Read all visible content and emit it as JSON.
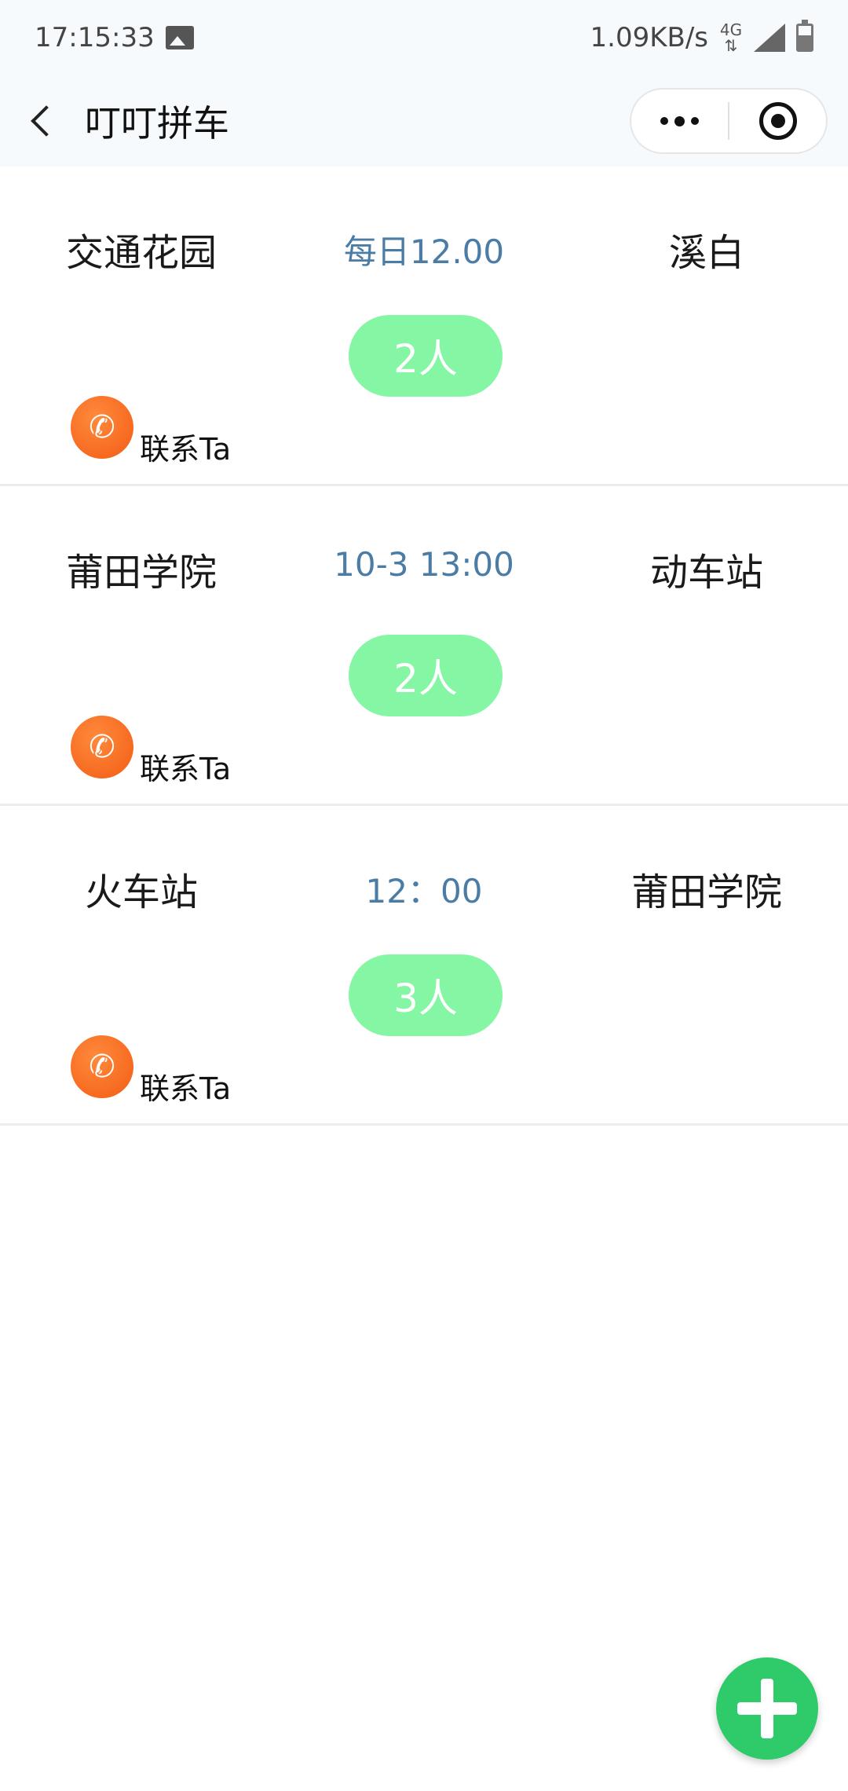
{
  "status_bar": {
    "time": "17:15:33",
    "network_speed": "1.09KB/s",
    "network_type": "4G",
    "icons": [
      "gallery-icon",
      "network-arrows-icon",
      "signal-icon",
      "battery-icon"
    ]
  },
  "nav": {
    "title": "叮叮拼车",
    "back_icon": "chevron-left-icon",
    "more_icon": "more-dots-icon",
    "close_icon": "target-circle-icon"
  },
  "rides": [
    {
      "from": "交通花园",
      "time": "每日12.00",
      "to": "溪白",
      "count": "2人",
      "contact_label": "联系Ta"
    },
    {
      "from": "莆田学院",
      "time": "10-3 13:00",
      "to": "动车站",
      "count": "2人",
      "contact_label": "联系Ta"
    },
    {
      "from": "火车站",
      "time": "12：00",
      "to": "莆田学院",
      "count": "3人",
      "contact_label": "联系Ta"
    }
  ],
  "fab": {
    "icon": "plus-icon"
  },
  "colors": {
    "accent_time": "#4a7ca6",
    "count_pill": "#85f7a4",
    "phone_orange": "#f25c14",
    "fab_green": "#2fcb6b",
    "header_bg": "#f6fafc"
  }
}
